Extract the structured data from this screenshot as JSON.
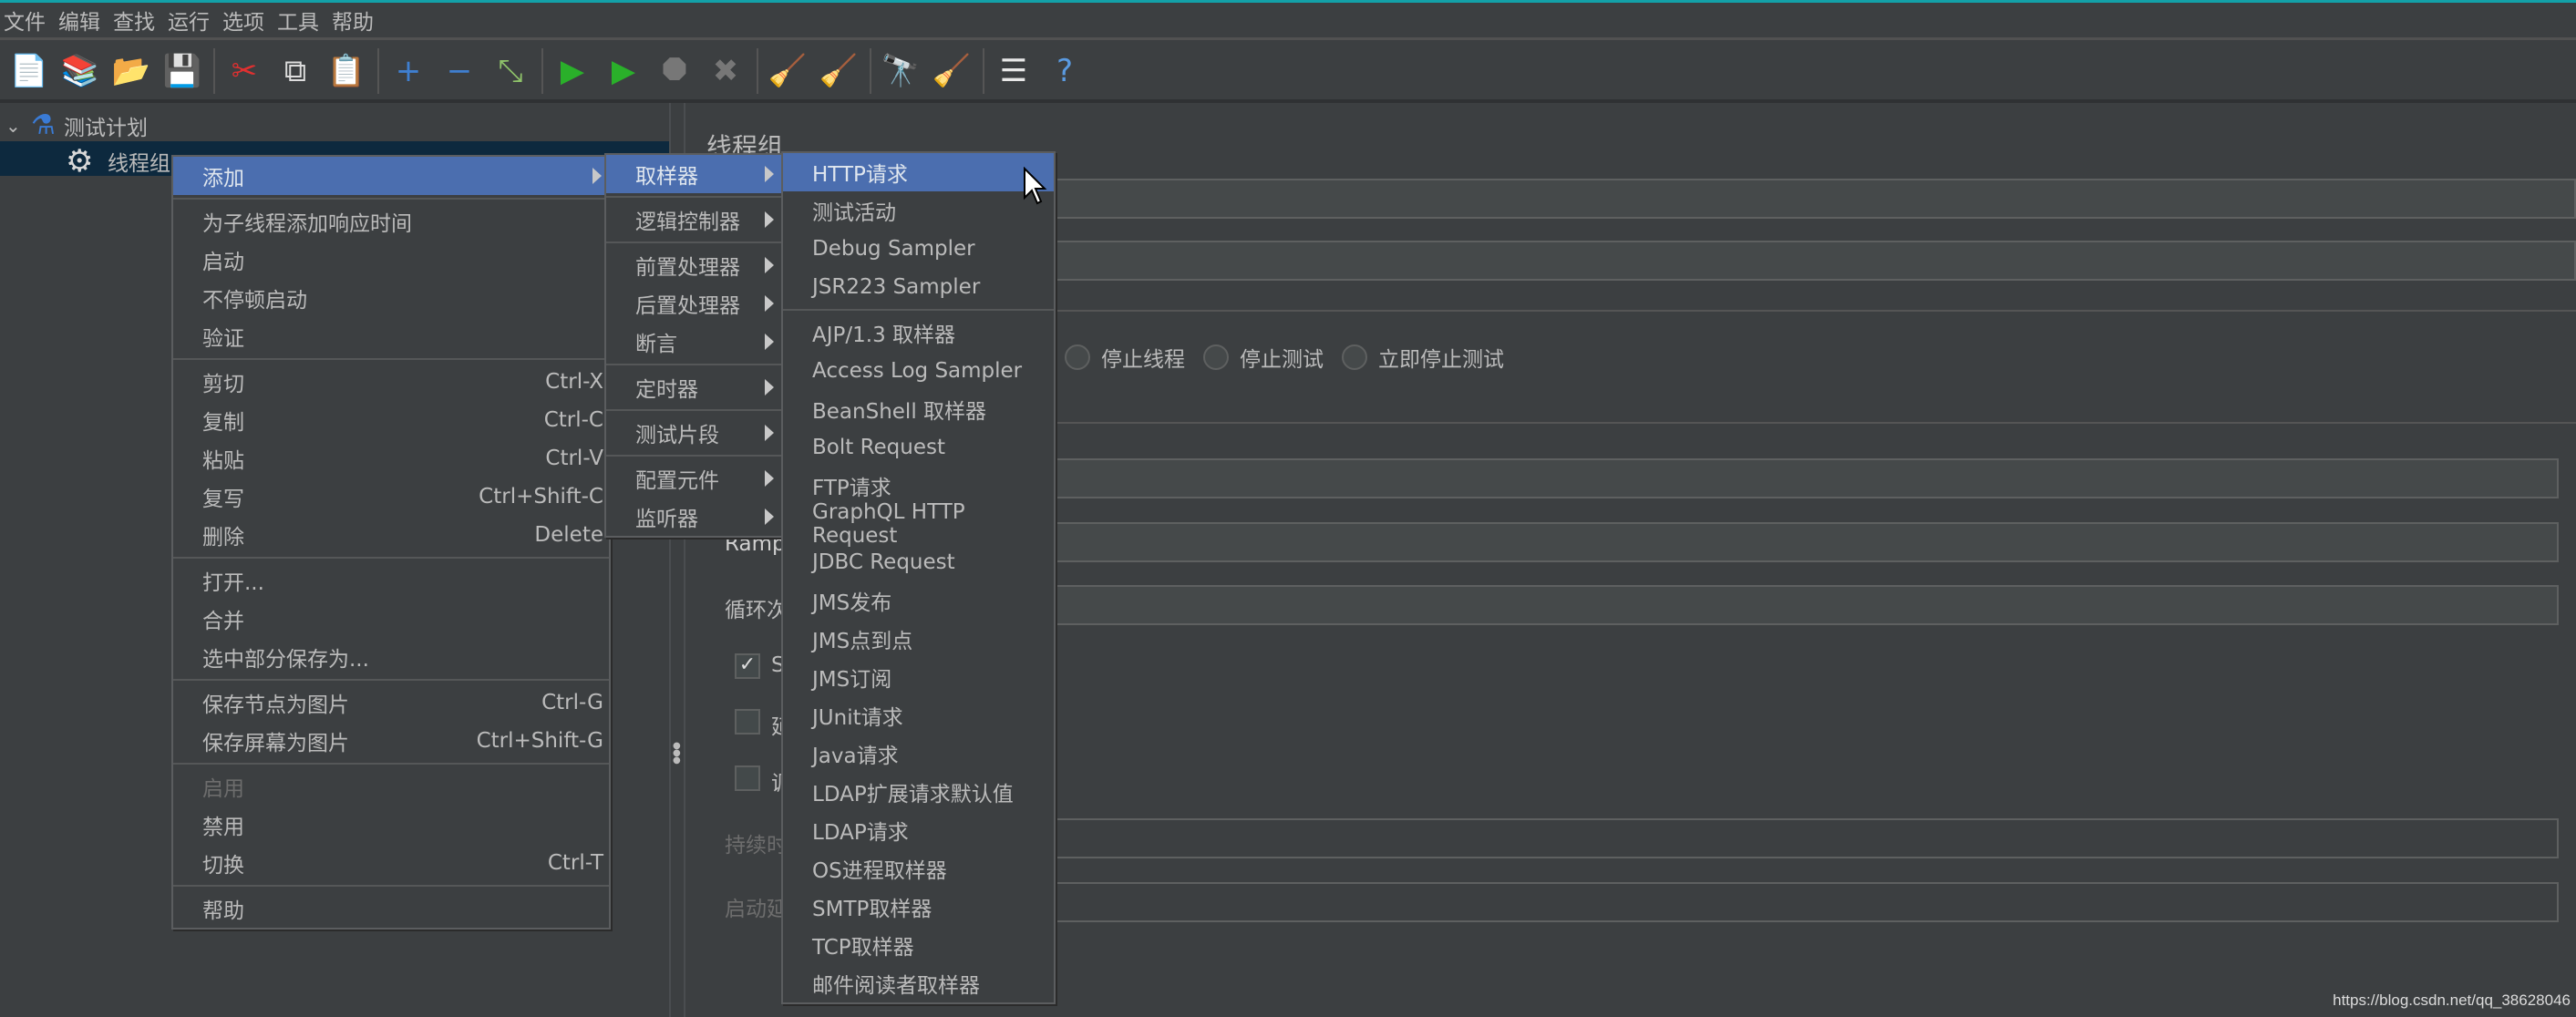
{
  "menubar": [
    "文件",
    "编辑",
    "查找",
    "运行",
    "选项",
    "工具",
    "帮助"
  ],
  "toolbar": [
    {
      "icon": "new-file-icon",
      "glyph": "📄",
      "color": "#e8e8e8"
    },
    {
      "icon": "templates-icon",
      "glyph": "📚",
      "color": "#3fae3a"
    },
    {
      "icon": "open-icon",
      "glyph": "📂",
      "color": "#e0a82e"
    },
    {
      "icon": "save-icon",
      "glyph": "💾",
      "color": "#cccccc"
    },
    {
      "sep": true
    },
    {
      "icon": "cut-icon",
      "glyph": "✂",
      "color": "#e03030"
    },
    {
      "icon": "copy-icon",
      "glyph": "⧉",
      "color": "#dddddd"
    },
    {
      "icon": "paste-icon",
      "glyph": "📋",
      "color": "#c98a2c"
    },
    {
      "sep": true
    },
    {
      "icon": "expand-icon",
      "glyph": "+",
      "color": "#3f7fd0"
    },
    {
      "icon": "collapse-icon",
      "glyph": "−",
      "color": "#3f7fd0"
    },
    {
      "icon": "toggle-icon",
      "glyph": "⤡",
      "color": "#8fc36a"
    },
    {
      "sep": true
    },
    {
      "icon": "start-icon",
      "glyph": "▶",
      "color": "#2ab02a"
    },
    {
      "icon": "start-no-pause-icon",
      "glyph": "▶",
      "color": "#2ab02a"
    },
    {
      "icon": "stop-icon",
      "glyph": "⯃",
      "color": "#777777"
    },
    {
      "icon": "shutdown-icon",
      "glyph": "✖",
      "color": "#777777"
    },
    {
      "sep": true
    },
    {
      "icon": "clear-icon",
      "glyph": "🧹",
      "color": "#b08a5a"
    },
    {
      "icon": "clear-all-icon",
      "glyph": "🧹",
      "color": "#b08a5a"
    },
    {
      "sep": true
    },
    {
      "icon": "search-icon",
      "glyph": "🔭",
      "color": "#cccccc"
    },
    {
      "icon": "reset-search-icon",
      "glyph": "🧹",
      "color": "#e6c02a"
    },
    {
      "sep": true
    },
    {
      "icon": "function-helper-icon",
      "glyph": "☰",
      "color": "#e8e8e8"
    },
    {
      "icon": "help-icon",
      "glyph": "?",
      "color": "#5a9ae0"
    }
  ],
  "tree": {
    "root": "测试计划",
    "child": "线程组"
  },
  "right_panel": {
    "title": "线程组",
    "radios": [
      "停止线程",
      "停止测试",
      "立即停止测试"
    ],
    "labels": {
      "ramp": "Ramp",
      "loop": "循环次",
      "chk1": "S",
      "chk2": "延",
      "chk3": "调",
      "duration": "持续时",
      "startup": "启动延"
    }
  },
  "context_menu": {
    "items": [
      {
        "label": "添加",
        "submenu": true,
        "selected": true
      },
      {
        "sep": true
      },
      {
        "label": "为子线程添加响应时间"
      },
      {
        "label": "启动"
      },
      {
        "label": "不停顿启动"
      },
      {
        "label": "验证"
      },
      {
        "sep": true
      },
      {
        "label": "剪切",
        "shortcut": "Ctrl-X"
      },
      {
        "label": "复制",
        "shortcut": "Ctrl-C"
      },
      {
        "label": "粘贴",
        "shortcut": "Ctrl-V"
      },
      {
        "label": "复写",
        "shortcut": "Ctrl+Shift-C"
      },
      {
        "label": "删除",
        "shortcut": "Delete"
      },
      {
        "sep": true
      },
      {
        "label": "打开..."
      },
      {
        "label": "合并"
      },
      {
        "label": "选中部分保存为..."
      },
      {
        "sep": true
      },
      {
        "label": "保存节点为图片",
        "shortcut": "Ctrl-G"
      },
      {
        "label": "保存屏幕为图片",
        "shortcut": "Ctrl+Shift-G"
      },
      {
        "sep": true
      },
      {
        "label": "启用",
        "disabled": true
      },
      {
        "label": "禁用"
      },
      {
        "label": "切换",
        "shortcut": "Ctrl-T"
      },
      {
        "sep": true
      },
      {
        "label": "帮助"
      }
    ]
  },
  "add_submenu": {
    "items": [
      {
        "label": "取样器",
        "selected": true
      },
      {
        "sep": true
      },
      {
        "label": "逻辑控制器"
      },
      {
        "sep": true
      },
      {
        "label": "前置处理器"
      },
      {
        "label": "后置处理器"
      },
      {
        "label": "断言"
      },
      {
        "sep": true
      },
      {
        "label": "定时器"
      },
      {
        "sep": true
      },
      {
        "label": "测试片段"
      },
      {
        "sep": true
      },
      {
        "label": "配置元件"
      },
      {
        "label": "监听器"
      }
    ]
  },
  "sampler_submenu": {
    "items": [
      {
        "label": "HTTP请求",
        "selected": true
      },
      {
        "label": "测试活动"
      },
      {
        "label": "Debug Sampler"
      },
      {
        "label": "JSR223 Sampler"
      },
      {
        "sep": true
      },
      {
        "label": "AJP/1.3 取样器"
      },
      {
        "label": "Access Log Sampler"
      },
      {
        "label": "BeanShell 取样器"
      },
      {
        "label": "Bolt Request"
      },
      {
        "label": "FTP请求"
      },
      {
        "label": "GraphQL HTTP Request"
      },
      {
        "label": "JDBC Request"
      },
      {
        "label": "JMS发布"
      },
      {
        "label": "JMS点到点"
      },
      {
        "label": "JMS订阅"
      },
      {
        "label": "JUnit请求"
      },
      {
        "label": "Java请求"
      },
      {
        "label": "LDAP扩展请求默认值"
      },
      {
        "label": "LDAP请求"
      },
      {
        "label": "OS进程取样器"
      },
      {
        "label": "SMTP取样器"
      },
      {
        "label": "TCP取样器"
      },
      {
        "label": "邮件阅读者取样器"
      }
    ]
  },
  "watermark": "https://blog.csdn.net/qq_38628046"
}
